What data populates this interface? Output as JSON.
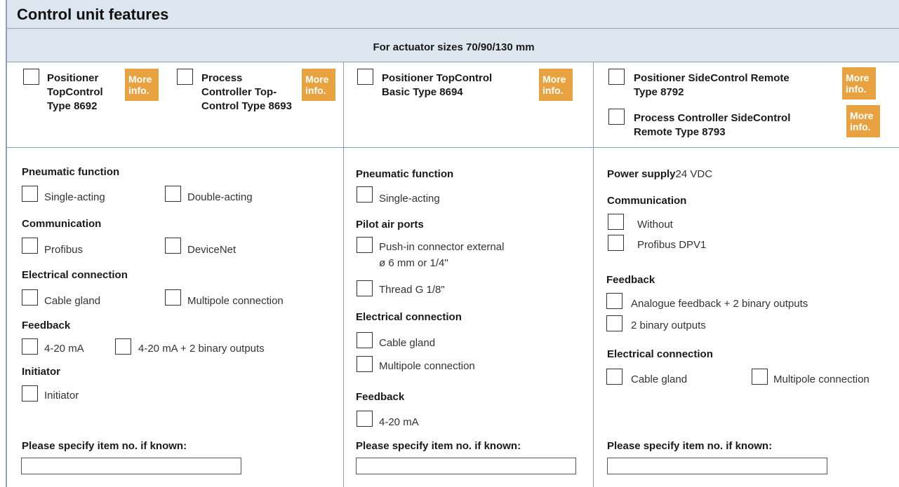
{
  "header": {
    "title": "Control unit features",
    "sizes_label": "For actuator sizes 70/90/130  mm"
  },
  "colors": {
    "header_bg": "#dde6ef",
    "border": "#8aa3b8",
    "badge": "#e8a340"
  },
  "badge": {
    "line1": "More",
    "line2": "info."
  },
  "products": {
    "p8692": [
      "Positioner",
      "TopControl",
      "Type 8692"
    ],
    "p8693": [
      "Process",
      "Controller Top-",
      "Control Type 8693"
    ],
    "p8694": [
      "Positioner TopControl",
      "Basic Type 8694"
    ],
    "p8792": [
      "Positioner SideControl Remote",
      "Type 8792"
    ],
    "p8793": [
      "Process Controller SideControl",
      "Remote Type 8793"
    ]
  },
  "col1": {
    "pneumatic_label": "Pneumatic function",
    "pneumatic_opt1": "Single-acting",
    "pneumatic_opt2": "Double-acting",
    "communication_label": "Communication",
    "communication_opt1": "Profibus",
    "communication_opt2": "DeviceNet",
    "electrical_label": "Electrical connection",
    "electrical_opt1": "Cable gland",
    "electrical_opt2": "Multipole connection",
    "feedback_label": "Feedback",
    "feedback_opt1": "4-20 mA",
    "feedback_opt2": "4-20 mA + 2 binary outputs",
    "initiator_label": "Initiator",
    "initiator_opt1": "Initiator",
    "item_no_label": "Please specify item no. if known:",
    "item_no_value": ""
  },
  "col2": {
    "pneumatic_label": "Pneumatic function",
    "pneumatic_opt1": "Single-acting",
    "pilot_label": "Pilot air ports",
    "pilot_opt1_line1": "Push-in connector external",
    "pilot_opt1_line2": "ø 6 mm or 1/4\"",
    "pilot_opt2": "Thread G 1/8\"",
    "electrical_label": "Electrical connection",
    "electrical_opt1": "Cable gland",
    "electrical_opt2": "Multipole connection",
    "feedback_label": "Feedback",
    "feedback_opt1": "4-20 mA",
    "item_no_label": "Please specify item no. if known:",
    "item_no_value": ""
  },
  "col3": {
    "power_label": "Power supply",
    "power_value": "24 VDC",
    "communication_label": "Communication",
    "communication_opt1": "Without",
    "communication_opt2": "Profibus DPV1",
    "feedback_label": "Feedback",
    "feedback_opt1": "Analogue feedback + 2 binary outputs",
    "feedback_opt2": "2 binary outputs",
    "electrical_label": "Electrical connection",
    "electrical_opt1": "Cable gland",
    "electrical_opt2": "Multipole connection",
    "item_no_label": "Please specify item no. if known:",
    "item_no_value": ""
  }
}
